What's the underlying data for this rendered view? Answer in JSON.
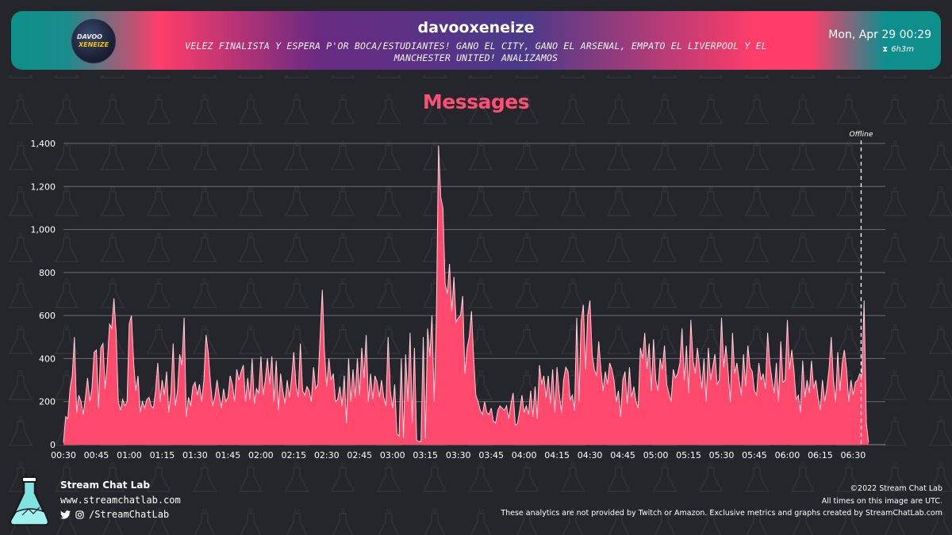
{
  "header": {
    "channel": "davooxeneize",
    "avatar_text_line1": "DAVOO",
    "avatar_text_line2": "XENEIZE",
    "title_line1": "VELEZ FINALISTA Y ESPERA P'OR BOCA/ESTUDIANTES! GANO EL CITY, GANO EL ARSENAL, EMPATO EL LIVERPOOL Y EL",
    "title_line2": "MANCHESTER UNITED! ANALIZAMOS",
    "date": "Mon, Apr 29 00:29",
    "duration": "6h3m"
  },
  "chart_title": "Messages",
  "chart_data": {
    "type": "area",
    "title": "Messages",
    "xlabel": "",
    "ylabel": "",
    "ylim": [
      0,
      1400
    ],
    "y_ticks": [
      "0",
      "200",
      "400",
      "600",
      "800",
      "1,000",
      "1,200",
      "1,400"
    ],
    "x_ticks": [
      "00:30",
      "00:45",
      "01:00",
      "01:15",
      "01:30",
      "01:45",
      "02:00",
      "02:15",
      "02:30",
      "02:45",
      "03:00",
      "03:15",
      "03:30",
      "03:45",
      "04:00",
      "04:15",
      "04:30",
      "04:45",
      "05:00",
      "05:15",
      "05:30",
      "05:45",
      "06:00",
      "06:15",
      "06:30"
    ],
    "grid": "horizontal",
    "x_start": "00:30",
    "offline_marker_time": "06:34",
    "offline_label": "Offline",
    "area_color": "#ff4a6e",
    "line_color": "#ffd1da",
    "points": [
      [
        "00:30",
        10
      ],
      [
        "00:31",
        130
      ],
      [
        "00:32",
        120
      ],
      [
        "00:33",
        260
      ],
      [
        "00:34",
        320
      ],
      [
        "00:35",
        500
      ],
      [
        "00:36",
        150
      ],
      [
        "00:37",
        230
      ],
      [
        "00:38",
        200
      ],
      [
        "00:39",
        140
      ],
      [
        "00:40",
        220
      ],
      [
        "00:41",
        310
      ],
      [
        "00:42",
        200
      ],
      [
        "00:43",
        260
      ],
      [
        "00:44",
        430
      ],
      [
        "00:45",
        440
      ],
      [
        "00:46",
        170
      ],
      [
        "00:47",
        450
      ],
      [
        "00:48",
        470
      ],
      [
        "00:49",
        260
      ],
      [
        "00:50",
        380
      ],
      [
        "00:51",
        560
      ],
      [
        "00:52",
        540
      ],
      [
        "00:53",
        680
      ],
      [
        "00:54",
        520
      ],
      [
        "00:55",
        200
      ],
      [
        "00:56",
        160
      ],
      [
        "00:57",
        210
      ],
      [
        "00:58",
        180
      ],
      [
        "00:59",
        200
      ],
      [
        "01:00",
        560
      ],
      [
        "01:01",
        600
      ],
      [
        "01:02",
        380
      ],
      [
        "01:03",
        250
      ],
      [
        "01:04",
        320
      ],
      [
        "01:05",
        150
      ],
      [
        "01:06",
        200
      ],
      [
        "01:07",
        170
      ],
      [
        "01:08",
        210
      ],
      [
        "01:09",
        220
      ],
      [
        "01:10",
        180
      ],
      [
        "01:11",
        170
      ],
      [
        "01:12",
        250
      ],
      [
        "01:13",
        380
      ],
      [
        "01:14",
        200
      ],
      [
        "01:15",
        300
      ],
      [
        "01:16",
        230
      ],
      [
        "01:17",
        340
      ],
      [
        "01:18",
        150
      ],
      [
        "01:19",
        240
      ],
      [
        "01:20",
        470
      ],
      [
        "01:21",
        180
      ],
      [
        "01:22",
        250
      ],
      [
        "01:23",
        420
      ],
      [
        "01:24",
        370
      ],
      [
        "01:25",
        590
      ],
      [
        "01:26",
        130
      ],
      [
        "01:27",
        220
      ],
      [
        "01:28",
        180
      ],
      [
        "01:29",
        270
      ],
      [
        "01:30",
        290
      ],
      [
        "01:31",
        230
      ],
      [
        "01:32",
        280
      ],
      [
        "01:33",
        200
      ],
      [
        "01:34",
        300
      ],
      [
        "01:35",
        510
      ],
      [
        "01:36",
        430
      ],
      [
        "01:37",
        290
      ],
      [
        "01:38",
        180
      ],
      [
        "01:39",
        220
      ],
      [
        "01:40",
        300
      ],
      [
        "01:41",
        230
      ],
      [
        "01:42",
        170
      ],
      [
        "01:43",
        260
      ],
      [
        "01:44",
        200
      ],
      [
        "01:45",
        220
      ],
      [
        "01:46",
        320
      ],
      [
        "01:47",
        280
      ],
      [
        "01:48",
        200
      ],
      [
        "01:49",
        350
      ],
      [
        "01:50",
        300
      ],
      [
        "01:51",
        340
      ],
      [
        "01:52",
        370
      ],
      [
        "01:53",
        200
      ],
      [
        "01:54",
        310
      ],
      [
        "01:55",
        210
      ],
      [
        "01:56",
        400
      ],
      [
        "01:57",
        190
      ],
      [
        "01:58",
        260
      ],
      [
        "01:59",
        240
      ],
      [
        "02:00",
        410
      ],
      [
        "02:01",
        230
      ],
      [
        "02:02",
        300
      ],
      [
        "02:03",
        400
      ],
      [
        "02:04",
        280
      ],
      [
        "02:05",
        410
      ],
      [
        "02:06",
        200
      ],
      [
        "02:07",
        390
      ],
      [
        "02:08",
        160
      ],
      [
        "02:09",
        330
      ],
      [
        "02:10",
        250
      ],
      [
        "02:11",
        190
      ],
      [
        "02:12",
        300
      ],
      [
        "02:13",
        220
      ],
      [
        "02:14",
        310
      ],
      [
        "02:15",
        430
      ],
      [
        "02:16",
        280
      ],
      [
        "02:17",
        220
      ],
      [
        "02:18",
        470
      ],
      [
        "02:19",
        250
      ],
      [
        "02:20",
        230
      ],
      [
        "02:21",
        270
      ],
      [
        "02:22",
        250
      ],
      [
        "02:23",
        200
      ],
      [
        "02:24",
        360
      ],
      [
        "02:25",
        260
      ],
      [
        "02:26",
        280
      ],
      [
        "02:27",
        500
      ],
      [
        "02:28",
        720
      ],
      [
        "02:29",
        430
      ],
      [
        "02:30",
        270
      ],
      [
        "02:31",
        400
      ],
      [
        "02:32",
        300
      ],
      [
        "02:33",
        330
      ],
      [
        "02:34",
        200
      ],
      [
        "02:35",
        210
      ],
      [
        "02:36",
        270
      ],
      [
        "02:37",
        180
      ],
      [
        "02:38",
        320
      ],
      [
        "02:39",
        100
      ],
      [
        "02:40",
        400
      ],
      [
        "02:41",
        200
      ],
      [
        "02:42",
        350
      ],
      [
        "02:43",
        220
      ],
      [
        "02:44",
        400
      ],
      [
        "02:45",
        230
      ],
      [
        "02:46",
        450
      ],
      [
        "02:47",
        310
      ],
      [
        "02:48",
        510
      ],
      [
        "02:49",
        200
      ],
      [
        "02:50",
        330
      ],
      [
        "02:51",
        210
      ],
      [
        "02:52",
        320
      ],
      [
        "02:53",
        290
      ],
      [
        "02:54",
        220
      ],
      [
        "02:55",
        300
      ],
      [
        "02:56",
        220
      ],
      [
        "02:57",
        180
      ],
      [
        "02:58",
        500
      ],
      [
        "02:59",
        250
      ],
      [
        "03:00",
        170
      ],
      [
        "03:01",
        280
      ],
      [
        "03:02",
        50
      ],
      [
        "03:03",
        40
      ],
      [
        "03:04",
        400
      ],
      [
        "03:05",
        30
      ],
      [
        "03:06",
        420
      ],
      [
        "03:07",
        200
      ],
      [
        "03:08",
        520
      ],
      [
        "03:09",
        100
      ],
      [
        "03:10",
        450
      ],
      [
        "03:11",
        20
      ],
      [
        "03:12",
        15
      ],
      [
        "03:13",
        15
      ],
      [
        "03:14",
        500
      ],
      [
        "03:15",
        30
      ],
      [
        "03:16",
        540
      ],
      [
        "03:17",
        410
      ],
      [
        "03:18",
        600
      ],
      [
        "03:19",
        200
      ],
      [
        "03:20",
        580
      ],
      [
        "03:21",
        1390
      ],
      [
        "03:22",
        1150
      ],
      [
        "03:23",
        1100
      ],
      [
        "03:24",
        750
      ],
      [
        "03:25",
        700
      ],
      [
        "03:26",
        840
      ],
      [
        "03:27",
        620
      ],
      [
        "03:28",
        780
      ],
      [
        "03:29",
        570
      ],
      [
        "03:30",
        590
      ],
      [
        "03:31",
        600
      ],
      [
        "03:32",
        690
      ],
      [
        "03:33",
        330
      ],
      [
        "03:34",
        450
      ],
      [
        "03:35",
        500
      ],
      [
        "03:36",
        620
      ],
      [
        "03:37",
        400
      ],
      [
        "03:38",
        230
      ],
      [
        "03:39",
        200
      ],
      [
        "03:40",
        160
      ],
      [
        "03:41",
        140
      ],
      [
        "03:42",
        200
      ],
      [
        "03:43",
        150
      ],
      [
        "03:44",
        140
      ],
      [
        "03:45",
        170
      ],
      [
        "03:46",
        110
      ],
      [
        "03:47",
        100
      ],
      [
        "03:48",
        160
      ],
      [
        "03:49",
        180
      ],
      [
        "03:50",
        170
      ],
      [
        "03:51",
        160
      ],
      [
        "03:52",
        180
      ],
      [
        "03:53",
        120
      ],
      [
        "03:54",
        190
      ],
      [
        "03:55",
        240
      ],
      [
        "03:56",
        90
      ],
      [
        "03:57",
        100
      ],
      [
        "03:58",
        160
      ],
      [
        "03:59",
        230
      ],
      [
        "04:00",
        150
      ],
      [
        "04:01",
        180
      ],
      [
        "04:02",
        140
      ],
      [
        "04:03",
        250
      ],
      [
        "04:04",
        130
      ],
      [
        "04:05",
        270
      ],
      [
        "04:06",
        120
      ],
      [
        "04:07",
        370
      ],
      [
        "04:08",
        280
      ],
      [
        "04:09",
        320
      ],
      [
        "04:10",
        220
      ],
      [
        "04:11",
        320
      ],
      [
        "04:12",
        190
      ],
      [
        "04:13",
        350
      ],
      [
        "04:14",
        150
      ],
      [
        "04:15",
        360
      ],
      [
        "04:16",
        240
      ],
      [
        "04:17",
        150
      ],
      [
        "04:18",
        300
      ],
      [
        "04:19",
        360
      ],
      [
        "04:20",
        340
      ],
      [
        "04:21",
        210
      ],
      [
        "04:22",
        230
      ],
      [
        "04:23",
        160
      ],
      [
        "04:24",
        590
      ],
      [
        "04:25",
        200
      ],
      [
        "04:26",
        570
      ],
      [
        "04:27",
        650
      ],
      [
        "04:28",
        350
      ],
      [
        "04:29",
        600
      ],
      [
        "04:30",
        670
      ],
      [
        "04:31",
        420
      ],
      [
        "04:32",
        350
      ],
      [
        "04:33",
        320
      ],
      [
        "04:34",
        480
      ],
      [
        "04:35",
        350
      ],
      [
        "04:36",
        250
      ],
      [
        "04:37",
        340
      ],
      [
        "04:38",
        280
      ],
      [
        "04:39",
        380
      ],
      [
        "04:40",
        350
      ],
      [
        "04:41",
        300
      ],
      [
        "04:42",
        200
      ],
      [
        "04:43",
        250
      ],
      [
        "04:44",
        130
      ],
      [
        "04:45",
        300
      ],
      [
        "04:46",
        340
      ],
      [
        "04:47",
        190
      ],
      [
        "04:48",
        360
      ],
      [
        "04:49",
        220
      ],
      [
        "04:50",
        270
      ],
      [
        "04:51",
        200
      ],
      [
        "04:52",
        170
      ],
      [
        "04:53",
        450
      ],
      [
        "04:54",
        400
      ],
      [
        "04:55",
        520
      ],
      [
        "04:56",
        350
      ],
      [
        "04:57",
        470
      ],
      [
        "04:58",
        250
      ],
      [
        "04:59",
        490
      ],
      [
        "05:00",
        300
      ],
      [
        "05:01",
        250
      ],
      [
        "05:02",
        400
      ],
      [
        "05:03",
        350
      ],
      [
        "05:04",
        460
      ],
      [
        "05:05",
        280
      ],
      [
        "05:06",
        240
      ],
      [
        "05:07",
        200
      ],
      [
        "05:08",
        350
      ],
      [
        "05:09",
        310
      ],
      [
        "05:10",
        330
      ],
      [
        "05:11",
        380
      ],
      [
        "05:12",
        540
      ],
      [
        "05:13",
        300
      ],
      [
        "05:14",
        460
      ],
      [
        "05:15",
        240
      ],
      [
        "05:16",
        580
      ],
      [
        "05:17",
        390
      ],
      [
        "05:18",
        330
      ],
      [
        "05:19",
        450
      ],
      [
        "05:20",
        360
      ],
      [
        "05:21",
        260
      ],
      [
        "05:22",
        400
      ],
      [
        "05:23",
        200
      ],
      [
        "05:24",
        450
      ],
      [
        "05:25",
        300
      ],
      [
        "05:26",
        360
      ],
      [
        "05:27",
        420
      ],
      [
        "05:28",
        280
      ],
      [
        "05:29",
        300
      ],
      [
        "05:30",
        590
      ],
      [
        "05:31",
        360
      ],
      [
        "05:32",
        460
      ],
      [
        "05:33",
        340
      ],
      [
        "05:34",
        200
      ],
      [
        "05:35",
        520
      ],
      [
        "05:36",
        330
      ],
      [
        "05:37",
        380
      ],
      [
        "05:38",
        300
      ],
      [
        "05:39",
        230
      ],
      [
        "05:40",
        420
      ],
      [
        "05:41",
        270
      ],
      [
        "05:42",
        460
      ],
      [
        "05:43",
        360
      ],
      [
        "05:44",
        340
      ],
      [
        "05:45",
        250
      ],
      [
        "05:46",
        230
      ],
      [
        "05:47",
        380
      ],
      [
        "05:48",
        300
      ],
      [
        "05:49",
        330
      ],
      [
        "05:50",
        260
      ],
      [
        "05:51",
        520
      ],
      [
        "05:52",
        380
      ],
      [
        "05:53",
        300
      ],
      [
        "05:54",
        240
      ],
      [
        "05:55",
        380
      ],
      [
        "05:56",
        200
      ],
      [
        "05:57",
        480
      ],
      [
        "05:58",
        290
      ],
      [
        "05:59",
        300
      ],
      [
        "06:00",
        580
      ],
      [
        "06:01",
        350
      ],
      [
        "06:02",
        440
      ],
      [
        "06:03",
        350
      ],
      [
        "06:04",
        210
      ],
      [
        "06:05",
        230
      ],
      [
        "06:06",
        150
      ],
      [
        "06:07",
        390
      ],
      [
        "06:08",
        220
      ],
      [
        "06:09",
        300
      ],
      [
        "06:10",
        240
      ],
      [
        "06:11",
        390
      ],
      [
        "06:12",
        260
      ],
      [
        "06:13",
        300
      ],
      [
        "06:14",
        220
      ],
      [
        "06:15",
        160
      ],
      [
        "06:16",
        300
      ],
      [
        "06:17",
        200
      ],
      [
        "06:18",
        260
      ],
      [
        "06:19",
        350
      ],
      [
        "06:20",
        500
      ],
      [
        "06:21",
        300
      ],
      [
        "06:22",
        200
      ],
      [
        "06:23",
        430
      ],
      [
        "06:24",
        250
      ],
      [
        "06:25",
        380
      ],
      [
        "06:26",
        440
      ],
      [
        "06:27",
        350
      ],
      [
        "06:28",
        200
      ],
      [
        "06:29",
        300
      ],
      [
        "06:30",
        230
      ],
      [
        "06:31",
        290
      ],
      [
        "06:32",
        300
      ],
      [
        "06:33",
        330
      ],
      [
        "06:34",
        320
      ],
      [
        "06:35",
        670
      ],
      [
        "06:36",
        100
      ],
      [
        "06:37",
        10
      ]
    ]
  },
  "footer": {
    "brand": "Stream Chat Lab",
    "url": "www.streamchatlab.com",
    "social_handle": "/StreamChatLab",
    "copyright": "©2022 Stream Chat Lab",
    "timezone_note": "All times on this image are UTC.",
    "disclaimer": "These analytics are not provided by Twitch or Amazon. Exclusive metrics and graphs created by StreamChatLab.com"
  },
  "colors": {
    "background": "#24262b",
    "accent": "#ff4f76",
    "teal": "#0d8f8a",
    "purple": "#4a3a8a"
  }
}
